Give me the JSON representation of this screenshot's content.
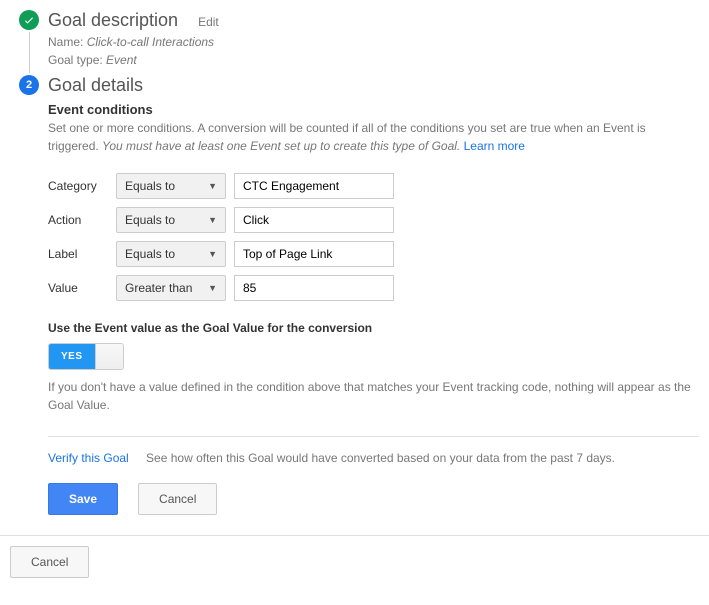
{
  "step1": {
    "title": "Goal description",
    "edit": "Edit",
    "name_label": "Name:",
    "name_value": "Click-to-call Interactions",
    "type_label": "Goal type:",
    "type_value": "Event"
  },
  "step2": {
    "number": "2",
    "title": "Goal details",
    "subheading": "Event conditions",
    "help_pre": "Set one or more conditions. A conversion will be counted if all of the conditions you set are true when an Event is triggered. ",
    "help_italic": "You must have at least one Event set up to create this type of Goal.",
    "learn_more": "Learn more",
    "conditions": {
      "category_label": "Category",
      "category_op": "Equals to",
      "category_val": "CTC Engagement",
      "action_label": "Action",
      "action_op": "Equals to",
      "action_val": "Click",
      "label_label": "Label",
      "label_op": "Equals to",
      "label_val": "Top of Page Link",
      "value_label": "Value",
      "value_op": "Greater than",
      "value_val": "85"
    },
    "goal_value": {
      "title": "Use the Event value as the Goal Value for the conversion",
      "yes": "YES",
      "help": "If you don't have a value defined in the condition above that matches your Event tracking code, nothing will appear as the Goal Value."
    },
    "verify": {
      "link": "Verify this Goal",
      "text": "See how often this Goal would have converted based on your data from the past 7 days."
    },
    "save": "Save",
    "cancel": "Cancel"
  },
  "footer_cancel": "Cancel"
}
